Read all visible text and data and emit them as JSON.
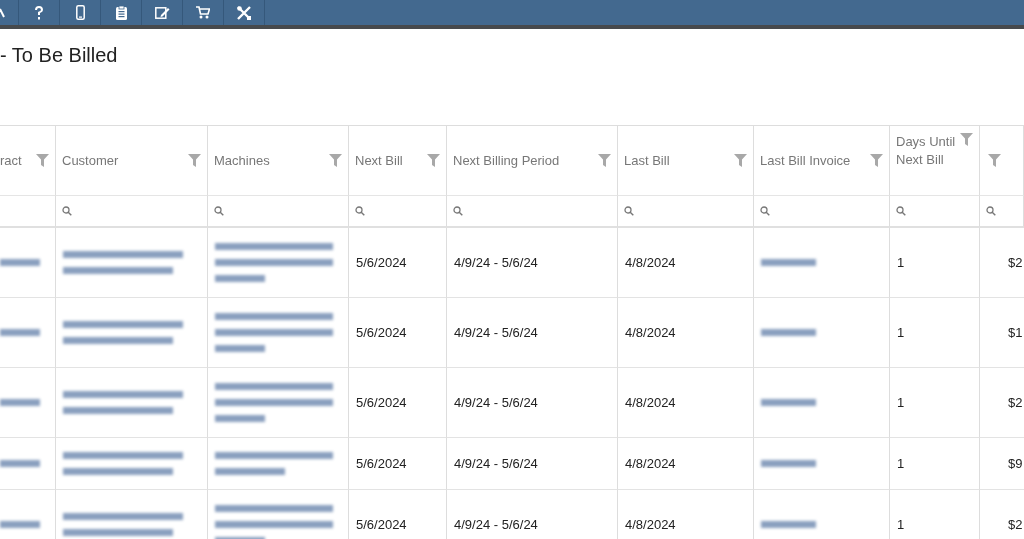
{
  "toolbar": [
    {
      "kind": "partial"
    },
    {
      "kind": "help"
    },
    {
      "kind": "mobile"
    },
    {
      "kind": "clipboard"
    },
    {
      "kind": "edit"
    },
    {
      "kind": "cart"
    },
    {
      "kind": "tools"
    }
  ],
  "page_title": "- To Be Billed",
  "table": {
    "columns": [
      {
        "label": "ract",
        "search_icon": false
      },
      {
        "label": "Customer",
        "search_icon": true
      },
      {
        "label": "Machines",
        "search_icon": true
      },
      {
        "label": "Next Bill",
        "search_icon": true
      },
      {
        "label": "Next Billing Period",
        "search_icon": true
      },
      {
        "label": "Last Bill",
        "search_icon": true
      },
      {
        "label": "Last Bill Invoice",
        "search_icon": true
      },
      {
        "label": "Days Until Next Bill",
        "search_icon": true
      },
      {
        "search_icon": true
      }
    ],
    "rows": [
      {
        "kind": "tall",
        "cells": [
          {
            "kind": "blurred"
          },
          {
            "kind": "blurred"
          },
          {
            "kind": "blurred"
          },
          {
            "kind": "text",
            "text": "5/6/2024"
          },
          {
            "kind": "text",
            "text": "4/9/24 - 5/6/24"
          },
          {
            "kind": "text",
            "text": "4/8/2024"
          },
          {
            "kind": "blurred"
          },
          {
            "kind": "text",
            "text": "1"
          },
          {
            "kind": "text",
            "text": "$2"
          }
        ]
      },
      {
        "kind": "tall",
        "cells": [
          {
            "kind": "blurred"
          },
          {
            "kind": "blurred"
          },
          {
            "kind": "blurred"
          },
          {
            "kind": "text",
            "text": "5/6/2024"
          },
          {
            "kind": "text",
            "text": "4/9/24 - 5/6/24"
          },
          {
            "kind": "text",
            "text": "4/8/2024"
          },
          {
            "kind": "blurred"
          },
          {
            "kind": "text",
            "text": "1"
          },
          {
            "kind": "text",
            "text": "$1"
          }
        ]
      },
      {
        "kind": "tall",
        "cells": [
          {
            "kind": "blurred"
          },
          {
            "kind": "blurred"
          },
          {
            "kind": "blurred"
          },
          {
            "kind": "text",
            "text": "5/6/2024"
          },
          {
            "kind": "text",
            "text": "4/9/24 - 5/6/24"
          },
          {
            "kind": "text",
            "text": "4/8/2024"
          },
          {
            "kind": "blurred"
          },
          {
            "kind": "text",
            "text": "1"
          },
          {
            "kind": "text",
            "text": "$2"
          }
        ]
      },
      {
        "kind": "short",
        "cells": [
          {
            "kind": "blurred"
          },
          {
            "kind": "blurred"
          },
          {
            "kind": "blurred"
          },
          {
            "kind": "text",
            "text": "5/6/2024"
          },
          {
            "kind": "text",
            "text": "4/9/24 - 5/6/24"
          },
          {
            "kind": "text",
            "text": "4/8/2024"
          },
          {
            "kind": "blurred"
          },
          {
            "kind": "text",
            "text": "1"
          },
          {
            "kind": "text",
            "text": "$9"
          }
        ]
      },
      {
        "kind": "tall",
        "cells": [
          {
            "kind": "blurred"
          },
          {
            "kind": "blurred"
          },
          {
            "kind": "blurred"
          },
          {
            "kind": "text",
            "text": "5/6/2024"
          },
          {
            "kind": "text",
            "text": "4/9/24 - 5/6/24"
          },
          {
            "kind": "text",
            "text": "4/8/2024"
          },
          {
            "kind": "blurred"
          },
          {
            "kind": "text",
            "text": "1"
          },
          {
            "kind": "text",
            "text": "$2"
          }
        ]
      }
    ]
  }
}
